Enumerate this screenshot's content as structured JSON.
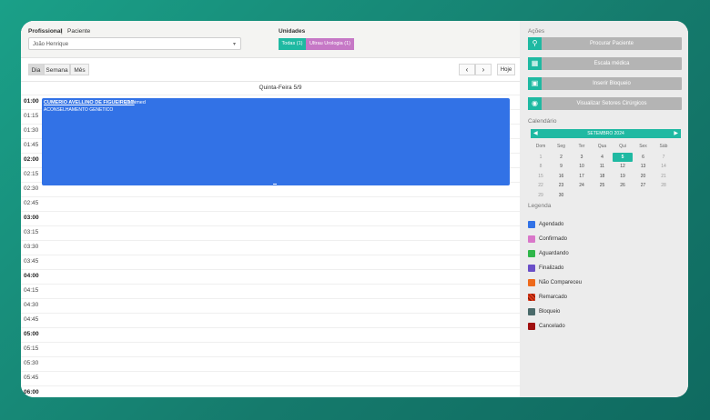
{
  "header": {
    "profissional_label": "Profissional",
    "separator": "|",
    "paciente_label": "Paciente",
    "professional_value": "João Henrique",
    "unidades_label": "Unidades",
    "unit_buttons": [
      {
        "label": "Todas (1)",
        "color": "#1fb9a2"
      },
      {
        "label": "Ultrau Urologia (1)",
        "color": "#c678c6"
      }
    ]
  },
  "toolbar": {
    "views": [
      "Dia",
      "Semana",
      "Mês"
    ],
    "active_view": "Dia",
    "prev": "‹",
    "next": "›",
    "today": "Hoje"
  },
  "calendar": {
    "day_title": "Quinta-Feira 5/9",
    "times": [
      "01:00",
      "01:15",
      "01:30",
      "01:45",
      "02:00",
      "02:15",
      "02:30",
      "02:45",
      "03:00",
      "03:15",
      "03:30",
      "03:45",
      "04:00",
      "04:15",
      "04:30",
      "04:45",
      "05:00",
      "05:15",
      "05:30",
      "05:45",
      "06:00"
    ],
    "event": {
      "patient": "CUMERIO AVELLINO DE FIGUEIREDO",
      "insurance": "| Unimed",
      "procedure": "ACONSELHAMENTO GENETICO",
      "color": "#3272e6"
    }
  },
  "sidebar": {
    "actions_title": "Ações",
    "actions": [
      {
        "label": "Procurar Paciente",
        "icon": "search-icon"
      },
      {
        "label": "Escala médica",
        "icon": "hospital-icon"
      },
      {
        "label": "Inserir Bloqueio",
        "icon": "lock-icon"
      },
      {
        "label": "Visualizar Setores Cirúrgicos",
        "icon": "eye-icon"
      }
    ],
    "calendar_title": "Calendário",
    "month_label": "SETEMBRO 2024",
    "weekdays": [
      "Dom",
      "Seg",
      "Ter",
      "Qua",
      "Qui",
      "Sex",
      "Sáb"
    ],
    "weeks": [
      [
        "1",
        "2",
        "3",
        "4",
        "5",
        "6",
        "7"
      ],
      [
        "8",
        "9",
        "10",
        "11",
        "12",
        "13",
        "14"
      ],
      [
        "15",
        "16",
        "17",
        "18",
        "19",
        "20",
        "21"
      ],
      [
        "22",
        "23",
        "24",
        "25",
        "26",
        "27",
        "28"
      ],
      [
        "29",
        "30",
        "",
        "",
        "",
        "",
        ""
      ]
    ],
    "selected_day": "5",
    "legend_title": "Legenda",
    "legend": [
      {
        "label": "Agendado",
        "color": "#3272e6"
      },
      {
        "label": "Confirmado",
        "color": "#d977c9"
      },
      {
        "label": "Aguardando",
        "color": "#2fb64a"
      },
      {
        "label": "Finalizado",
        "color": "#6a4fc8"
      },
      {
        "label": "Não Compareceu",
        "color": "#ee6a1c"
      },
      {
        "label": "Remarcado",
        "color": "#e03a1a"
      },
      {
        "label": "Bloqueio",
        "color": "#4a6a6a"
      },
      {
        "label": "Cancelado",
        "color": "#a01010"
      }
    ]
  }
}
